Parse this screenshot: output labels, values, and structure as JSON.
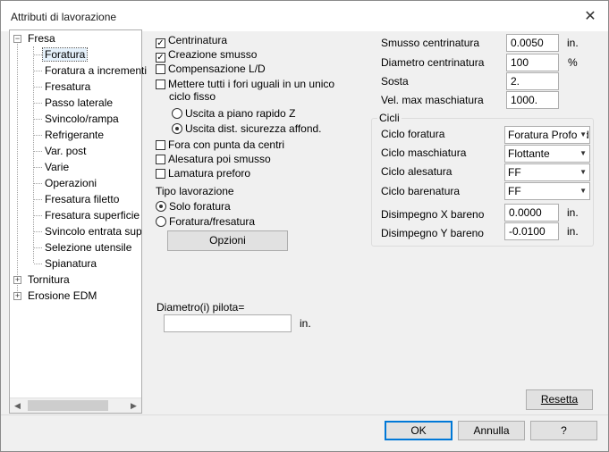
{
  "window": {
    "title": "Attributi di lavorazione",
    "close_glyph": "✕"
  },
  "tree": {
    "root": "Fresa",
    "root_expander": "−",
    "children": [
      "Foratura",
      "Foratura a incrementi",
      "Fresatura",
      "Passo laterale",
      "Svincolo/rampa",
      "Refrigerante",
      "Var. post",
      "Varie",
      "Operazioni",
      "Fresatura filetto",
      "Fresatura superficie",
      "Svincolo entrata superficie",
      "Selezione utensile",
      "Spianatura"
    ],
    "others": [
      "Tornitura",
      "Erosione EDM"
    ],
    "collapsed_expander": "+",
    "selected": "Foratura",
    "scroll_left": "◀",
    "scroll_right": "▶"
  },
  "options": {
    "centratura": {
      "label": "Centrinatura",
      "checked": true
    },
    "smusso": {
      "label": "Creazione smusso",
      "checked": true
    },
    "compensazione": {
      "label": "Compensazione L/D",
      "checked": false
    },
    "uguali": {
      "label_line1": "Mettere tutti i fori uguali in un unico",
      "label_line2": "ciclo fisso",
      "checked": false
    },
    "uscita_rapido": {
      "label": "Uscita a piano rapido Z",
      "selected": false
    },
    "uscita_sicurezza": {
      "label": "Uscita dist. sicurezza affond.",
      "selected": true
    },
    "punta_centri": {
      "label": "Fora con punta da centri",
      "checked": false
    },
    "alesatura_smusso": {
      "label": "Alesatura poi smusso",
      "checked": false
    },
    "lamatura": {
      "label": "Lamatura preforo",
      "checked": false
    },
    "check_glyph": "✓"
  },
  "tipo": {
    "title": "Tipo lavorazione",
    "solo": {
      "label": "Solo foratura",
      "selected": true
    },
    "foratura_fresatura": {
      "label": "Foratura/fresatura",
      "selected": false
    },
    "opzioni_button": "Opzioni"
  },
  "diametro_pilota": {
    "label": "Diametro(i) pilota=",
    "value": "",
    "unit": "in."
  },
  "params": [
    {
      "label": "Smusso centrinatura",
      "value": "0.0050",
      "unit": "in."
    },
    {
      "label": "Diametro centrinatura",
      "value": "100",
      "unit": "%"
    },
    {
      "label": "Sosta",
      "value": "2.",
      "unit": ""
    },
    {
      "label": "Vel. max maschiatura",
      "value": "1000.",
      "unit": ""
    }
  ],
  "cicli": {
    "title": "Cicli",
    "ciclo_foratura": {
      "label": "Ciclo foratura",
      "value": "Foratura Profonda"
    },
    "ciclo_maschiatura": {
      "label": "Ciclo maschiatura",
      "value": "Flottante"
    },
    "ciclo_alesatura": {
      "label": "Ciclo alesatura",
      "value": "FF"
    },
    "ciclo_barenatura": {
      "label": "Ciclo barenatura",
      "value": "FF"
    },
    "disimpegno_x": {
      "label": "Disimpegno X bareno",
      "value": "0.0000",
      "unit": "in."
    },
    "disimpegno_y": {
      "label": "Disimpegno Y bareno",
      "value": "-0.0100",
      "unit": "in."
    },
    "dropdown_glyph": "▼"
  },
  "buttons": {
    "resetta": "Resetta",
    "ok": "OK",
    "annulla": "Annulla",
    "help": "?"
  }
}
